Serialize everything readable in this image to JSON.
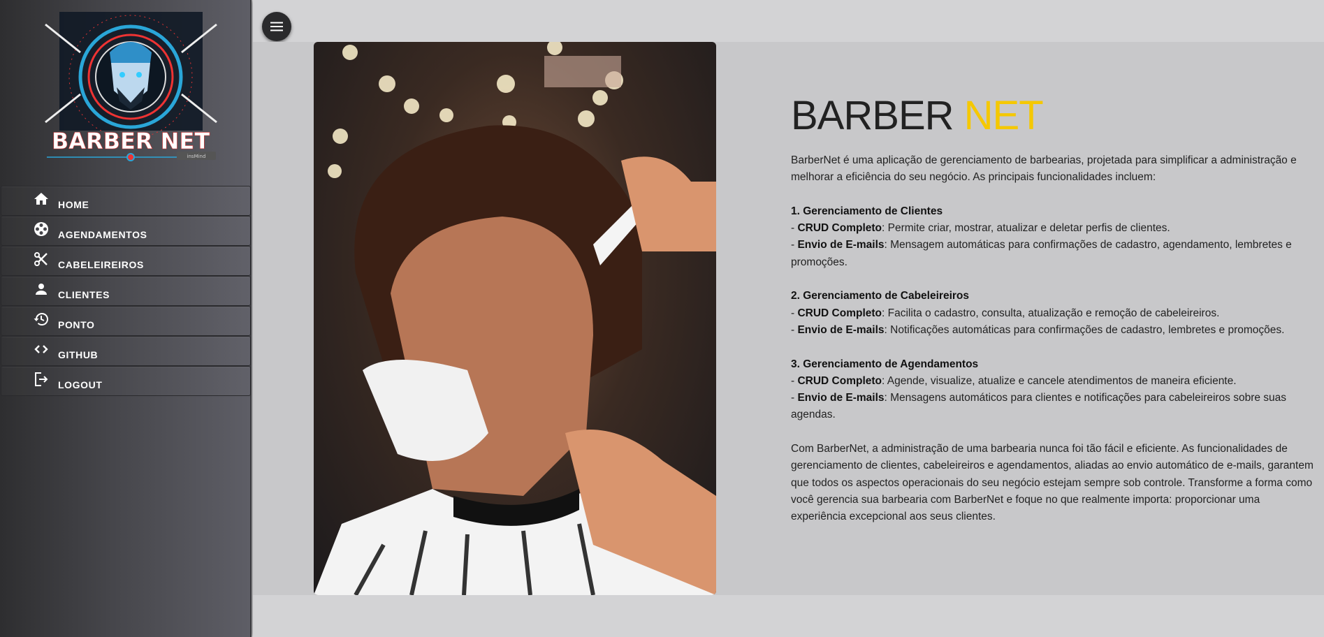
{
  "logo": {
    "text": "BARBER NET",
    "watermark": "insMind"
  },
  "sidebar": {
    "items": [
      {
        "label": "HOME",
        "icon": "home-icon"
      },
      {
        "label": "AGENDAMENTOS",
        "icon": "film-reel-icon"
      },
      {
        "label": "CABELEIREIROS",
        "icon": "scissors-icon"
      },
      {
        "label": "CLIENTES",
        "icon": "person-icon"
      },
      {
        "label": "PONTO",
        "icon": "history-icon"
      },
      {
        "label": "GITHUB",
        "icon": "code-icon"
      },
      {
        "label": "LOGOUT",
        "icon": "logout-icon"
      }
    ]
  },
  "header": {
    "menu_icon": "hamburger-icon"
  },
  "main": {
    "title_a": "BARBER",
    "title_b": "NET",
    "accent": "#f5c800",
    "intro": "BarberNet é uma aplicação de gerenciamento de barbearias, projetada para simplificar a administração e melhorar a eficiência do seu negócio. As principais funcionalidades incluem:",
    "sections": [
      {
        "heading": "1. Gerenciamento de Clientes",
        "crud_label": "CRUD Completo",
        "crud_text": ": Permite criar, mostrar, atualizar e deletar perfis de clientes.",
        "email_label": "Envio de E-mails",
        "email_text": ": Mensagem automáticas para confirmações de cadastro, agendamento, lembretes e promoções."
      },
      {
        "heading": "2. Gerenciamento de Cabeleireiros",
        "crud_label": "CRUD Completo",
        "crud_text": ": Facilita o cadastro, consulta, atualização e remoção de cabeleireiros.",
        "email_label": "Envio de E-mails",
        "email_text": ": Notificações automáticas para confirmações de cadastro, lembretes e promoções."
      },
      {
        "heading": "3. Gerenciamento de Agendamentos",
        "crud_label": "CRUD Completo",
        "crud_text": ": Agende, visualize, atualize e cancele atendimentos de maneira eficiente.",
        "email_label": "Envio de E-mails",
        "email_text": ": Mensagens automáticos para clientes e notificações para cabeleireiros sobre suas agendas."
      }
    ],
    "dash": "- ",
    "conclusion": "Com BarberNet, a administração de uma barbearia nunca foi tão fácil e eficiente. As funcionalidades de gerenciamento de clientes, cabeleireiros e agendamentos, aliadas ao envio automático de e-mails, garantem que todos os aspectos operacionais do seu negócio estejam sempre sob controle. Transforme a forma como você gerencia sua barbearia com BarberNet e foque no que realmente importa: proporcionar uma experiência excepcional aos seus clientes."
  }
}
